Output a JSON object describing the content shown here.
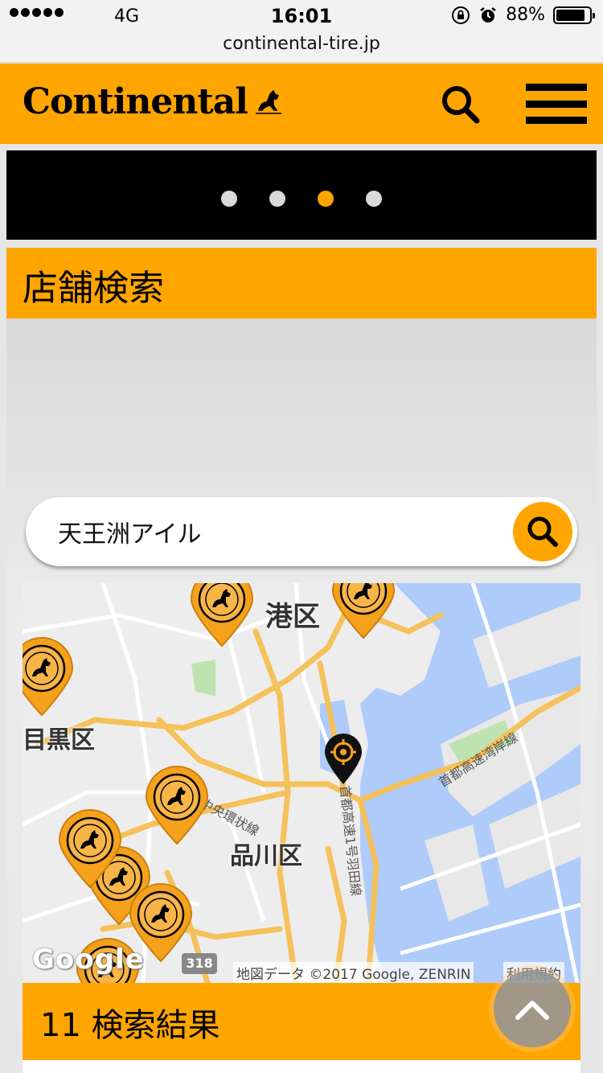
{
  "status_bar": {
    "network": "4G",
    "time": "16:01",
    "battery": "88%",
    "battery_level": 0.88
  },
  "browser": {
    "url": "continental-tire.jp"
  },
  "header": {
    "logo_text": "Continental",
    "search_icon": "search-icon",
    "menu_icon": "hamburger-menu-icon"
  },
  "carousel": {
    "dot_count": 4,
    "active_index": 2
  },
  "section": {
    "title": "店舗検索"
  },
  "search": {
    "value": "天王洲アイル",
    "button_icon": "search-icon"
  },
  "map": {
    "labels": {
      "minato": "港区",
      "meguro": "目黒区",
      "shinagawa": "品川区",
      "expressway_central": "首都高速中央環状線",
      "expressway_bayshore": "首都高速湾岸線",
      "expressway_haneda": "首都高速1号羽田線",
      "route": "318"
    },
    "google_logo": "Google",
    "attribution": "地図データ ©2017 Google, ZENRIN",
    "terms": "利用規約",
    "colors": {
      "water": "#aecbfa",
      "land": "#ededed",
      "road": "#f5c15a",
      "pin": "#f5a11b"
    }
  },
  "results": {
    "label": "11 検索結果"
  },
  "scroll_top_icon": "chevron-up-icon"
}
